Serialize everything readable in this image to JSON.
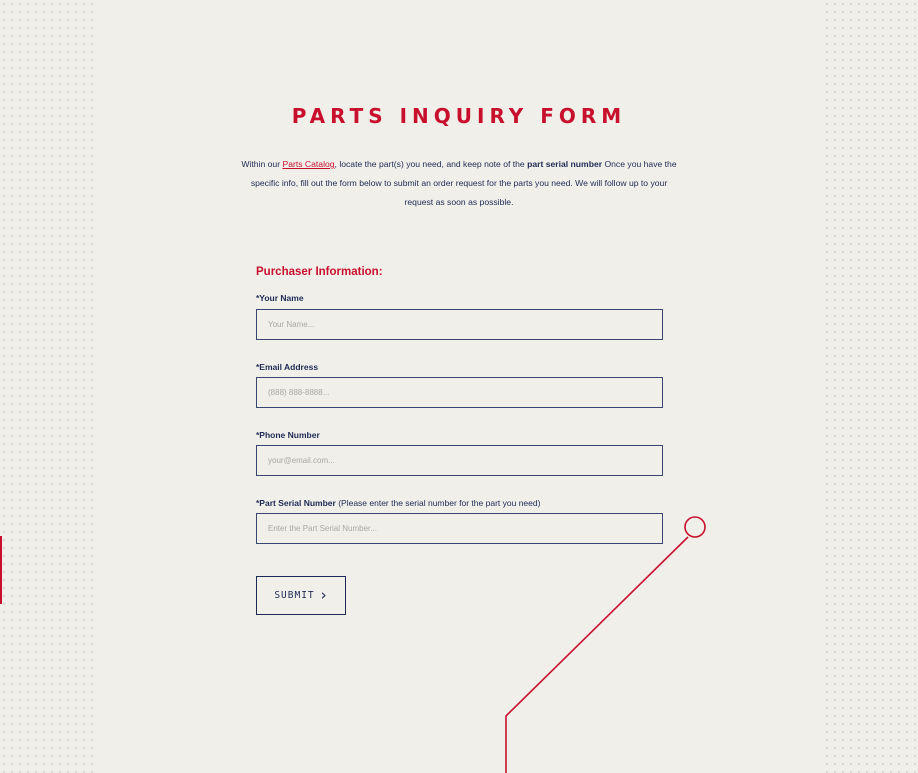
{
  "form": {
    "title": "PARTS INQUIRY FORM",
    "intro": {
      "part1": "Within our ",
      "catalog_link": "Parts Catalog",
      "part2": ", locate the part(s) you need, and keep note of the ",
      "bold_text": "part serial number",
      "part3": " Once you have the specific info, fill out the form below to submit an order request for the parts you need. We will follow up to your request as soon as possible."
    },
    "section_title": "Purchaser Information:",
    "fields": {
      "name": {
        "label": "*Your Name",
        "placeholder": "Your Name...",
        "value": ""
      },
      "email": {
        "label": "*Email Address",
        "placeholder": "(888) 888-8888...",
        "value": ""
      },
      "phone": {
        "label": "*Phone Number",
        "placeholder": "your@email.com...",
        "value": ""
      },
      "serial": {
        "label": "*Part Serial Number",
        "hint": " (Please enter the serial number for the part you need)",
        "placeholder": "Enter the Part Serial Number...",
        "value": ""
      }
    },
    "submit_label": "SUBMIT",
    "submit_icon": "chevron-right-icon"
  },
  "colors": {
    "accent": "#c8102e",
    "navy": "#1e2a55",
    "background": "#f1efe9"
  }
}
